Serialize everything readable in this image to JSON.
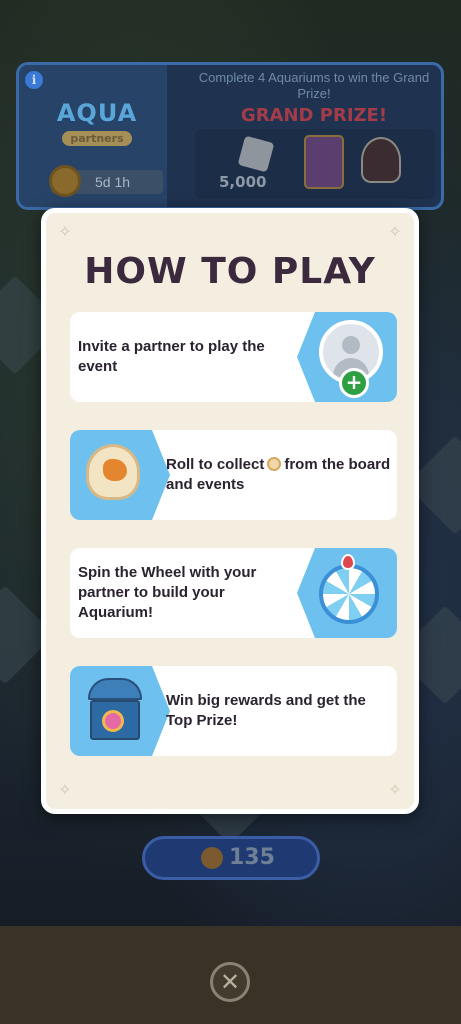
{
  "event_banner": {
    "logo_top": "AQUA",
    "logo_bottom": "partners",
    "timer": "5d 1h",
    "headline": "Complete 4 Aquariums to win the Grand Prize!",
    "grand_prize_label": "GRAND PRIZE!",
    "dice_amount": "5,000"
  },
  "modal": {
    "title": "HOW TO PLAY",
    "steps": [
      {
        "text": "Invite a partner to play the event",
        "icon": "add-partner-icon"
      },
      {
        "text_before": "Roll to collect",
        "text_after": "from the board and events",
        "icon": "shell-icon"
      },
      {
        "text": "Spin the Wheel with your partner to build your Aquarium!",
        "icon": "wheel-icon"
      },
      {
        "text": "Win big rewards and get the Top Prize!",
        "icon": "treasure-chest-icon"
      }
    ]
  },
  "roll_counter": {
    "count": "135"
  },
  "close_button": {
    "label": "✕"
  },
  "colors": {
    "modal_bg": "#f4eee0",
    "title": "#3b2a3e",
    "art_blue": "#6ec1ee",
    "plus_green": "#2ea043"
  }
}
